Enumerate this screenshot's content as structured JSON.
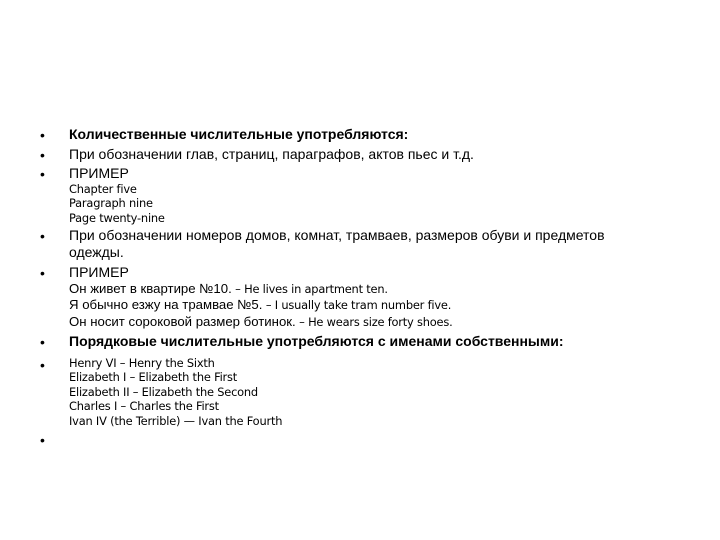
{
  "slide": {
    "items": [
      {
        "bullet": "•",
        "text": "Количественные числительные употребляются:"
      },
      {
        "bullet": "•",
        "text": "При обозначении глав, страниц, параграфов, актов пьес и т.д."
      },
      {
        "bullet": "•",
        "heading": "ПРИМЕР",
        "lines": [
          "Chapter five",
          "Paragraph nine",
          "Page twenty-nine"
        ]
      },
      {
        "bullet": "•",
        "line1": "При обозначении номеров домов, комнат, трамваев, размеров обуви и предметов",
        "line2": "одежды."
      },
      {
        "bullet": "•",
        "heading": "ПРИМЕР",
        "examples": [
          {
            "ru": "Он живет в квартире №10.",
            "en": " – He lives in apartment ten."
          },
          {
            "ru": "Я обычно езжу на трамвае №5.",
            "en": " – I usually take tram number five."
          },
          {
            "ru": "Он носит сороковой размер ботинок.",
            "en": " – He wears size forty shoes."
          }
        ]
      },
      {
        "bullet": "•",
        "text": "Порядковые числительные употребляются с именами собственными:"
      },
      {
        "bullet": "•",
        "lines": [
          "Henry VI – Henry the Sixth",
          "Elizabeth I – Elizabeth the First",
          "Elizabeth II – Elizabeth the Second",
          "Charles I – Charles the First",
          "Ivan IV (the Terrible) —  Ivan the Fourth"
        ]
      },
      {
        "bullet": "•"
      }
    ]
  }
}
